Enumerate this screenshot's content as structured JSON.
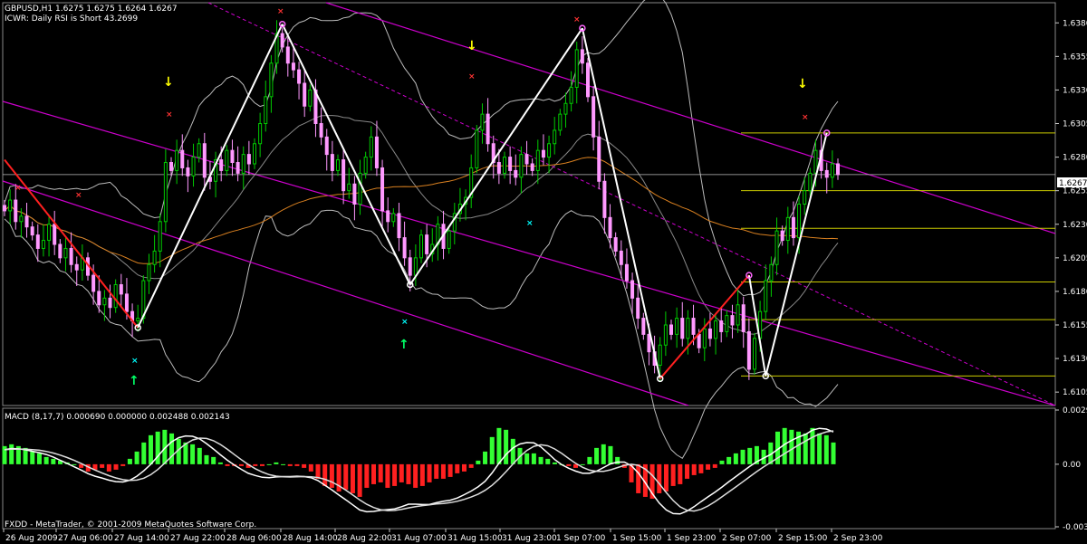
{
  "header": {
    "symbol_line": "GBPUSD,H1  1.6275 1.6275 1.6264 1.6267",
    "indicator_line": "ICWR: Daily RSI is Short 43.2699"
  },
  "macd_label": "MACD  (8,17,7) 0.000690 0.000000 0.002488 0.002143",
  "copyright": "FXDD - MetaTrader, © 2001-2009 MetaQuotes Software Corp.",
  "price_box": "1.6267",
  "colors": {
    "background": "#000000",
    "bull_candle": "#00cc00",
    "bear_candle": "#ff99ff",
    "zigzag": "#ffffff",
    "channel": "#cc00cc",
    "fib_levels": "#cccc00",
    "macd_positive": "#33ff33",
    "macd_negative": "#ff2020"
  },
  "chart_data": [
    {
      "type": "candlestick",
      "yaxis_ticks": [
        "1.6380",
        "1.6355",
        "1.6330",
        "1.6305",
        "1.6280",
        "1.6255",
        "1.6230",
        "1.6205",
        "1.6180",
        "1.6155",
        "1.6130",
        "1.6105"
      ],
      "ylim": [
        1.6095,
        1.6395
      ],
      "x_ticks": [
        "26 Aug 2009",
        "27 Aug 06:00",
        "27 Aug 14:00",
        "27 Aug 22:00",
        "28 Aug 06:00",
        "28 Aug 14:00",
        "28 Aug 22:00",
        "31 Aug 07:00",
        "31 Aug 15:00",
        "31 Aug 23:00",
        "1 Sep 07:00",
        "1 Sep 15:00",
        "1 Sep 23:00",
        "2 Sep 07:00",
        "2 Sep 15:00",
        "2 Sep 23:00"
      ],
      "current_price": 1.6267,
      "zigzag_points": [
        {
          "bar": 0,
          "price": 1.6278
        },
        {
          "bar": 24,
          "price": 1.6153
        },
        {
          "bar": 50,
          "price": 1.6379
        },
        {
          "bar": 73,
          "price": 1.6185
        },
        {
          "bar": 104,
          "price": 1.6376
        },
        {
          "bar": 118,
          "price": 1.6115
        },
        {
          "bar": 134,
          "price": 1.6192
        },
        {
          "bar": 137,
          "price": 1.6117
        },
        {
          "bar": 148,
          "price": 1.6298
        }
      ],
      "fib_levels": [
        1.6298,
        1.6255,
        1.6227,
        1.6187,
        1.6159,
        1.6117
      ],
      "closes": [
        1.624,
        1.6248,
        1.6232,
        1.6236,
        1.6228,
        1.6222,
        1.6212,
        1.6218,
        1.623,
        1.6215,
        1.6205,
        1.6212,
        1.62,
        1.6196,
        1.6205,
        1.6192,
        1.618,
        1.617,
        1.6175,
        1.6168,
        1.6185,
        1.6178,
        1.6165,
        1.6158,
        1.616,
        1.6188,
        1.62,
        1.621,
        1.6232,
        1.6276,
        1.627,
        1.6285,
        1.6272,
        1.6266,
        1.628,
        1.629,
        1.6265,
        1.6262,
        1.6278,
        1.627,
        1.6285,
        1.6276,
        1.6268,
        1.6282,
        1.6275,
        1.629,
        1.6305,
        1.6325,
        1.635,
        1.6372,
        1.6362,
        1.635,
        1.6345,
        1.6335,
        1.6318,
        1.633,
        1.6305,
        1.6295,
        1.6282,
        1.627,
        1.6278,
        1.6255,
        1.626,
        1.6245,
        1.6268,
        1.628,
        1.6295,
        1.6272,
        1.624,
        1.6232,
        1.6238,
        1.622,
        1.6205,
        1.6192,
        1.6205,
        1.6222,
        1.6208,
        1.6215,
        1.623,
        1.6212,
        1.6225,
        1.6238,
        1.6245,
        1.625,
        1.6272,
        1.63,
        1.6312,
        1.629,
        1.6276,
        1.6268,
        1.628,
        1.627,
        1.6265,
        1.6282,
        1.6275,
        1.627,
        1.6285,
        1.628,
        1.629,
        1.63,
        1.6312,
        1.632,
        1.6332,
        1.636,
        1.635,
        1.6325,
        1.6295,
        1.6262,
        1.6235,
        1.622,
        1.621,
        1.62,
        1.6188,
        1.6175,
        1.616,
        1.6148,
        1.6135,
        1.6125,
        1.614,
        1.6155,
        1.6148,
        1.616,
        1.6145,
        1.616,
        1.6148,
        1.6138,
        1.6152,
        1.6145,
        1.6158,
        1.615,
        1.6162,
        1.6155,
        1.617,
        1.615,
        1.6122,
        1.6145,
        1.6165,
        1.6188,
        1.62,
        1.6225,
        1.6218,
        1.6235,
        1.622,
        1.6245,
        1.6255,
        1.6268,
        1.6285,
        1.627,
        1.6265,
        1.6275,
        1.6267
      ]
    },
    {
      "type": "bar",
      "name": "MACD",
      "yaxis_ticks": [
        "0.00299",
        "0.00",
        "-0.00345"
      ],
      "ylim": [
        -0.00345,
        0.00299
      ],
      "histogram": [
        0.001,
        0.0011,
        0.001,
        0.0009,
        0.0007,
        0.0006,
        0.0004,
        0.0003,
        0.0002,
        0.0001,
        0.0,
        -0.0002,
        -0.0004,
        -0.0003,
        -0.0002,
        -0.0004,
        -0.0003,
        -0.0001,
        0.0003,
        0.0007,
        0.0012,
        0.0016,
        0.0018,
        0.0019,
        0.0017,
        0.0014,
        0.0012,
        0.0011,
        0.0009,
        0.0005,
        0.0004,
        0.0001,
        -0.0001,
        -0.0001,
        -0.0001,
        -0.0002,
        -0.0001,
        -0.0001,
        0.0,
        0.0001,
        0.0,
        -0.0001,
        -0.0001,
        -0.0002,
        -0.0004,
        -0.0008,
        -0.0012,
        -0.0013,
        -0.0015,
        -0.0014,
        -0.0016,
        -0.0018,
        -0.0013,
        -0.0011,
        -0.001,
        -0.0013,
        -0.0012,
        -0.001,
        -0.0011,
        -0.0013,
        -0.0012,
        -0.001,
        -0.0008,
        -0.0008,
        -0.0007,
        -0.0005,
        -0.0004,
        -0.0002,
        0.0002,
        0.0007,
        0.0015,
        0.002,
        0.0019,
        0.0014,
        0.0009,
        0.0006,
        0.0006,
        0.0004,
        0.0003,
        0.0001,
        0.0,
        -0.0001,
        -0.0002,
        0.0,
        0.0004,
        0.0009,
        0.0011,
        0.001,
        0.0004,
        -0.0002,
        -0.001,
        -0.0016,
        -0.0018,
        -0.0019,
        -0.0016,
        -0.0015,
        -0.0012,
        -0.0011,
        -0.0008,
        -0.0006,
        -0.0005,
        -0.0003,
        -0.0002,
        0.0002,
        0.0004,
        0.0006,
        0.0008,
        0.0009,
        0.001,
        0.0008,
        0.0012,
        0.0018,
        0.002,
        0.0019,
        0.0018,
        0.0017,
        0.002,
        0.0017,
        0.0016,
        0.0012
      ]
    }
  ]
}
